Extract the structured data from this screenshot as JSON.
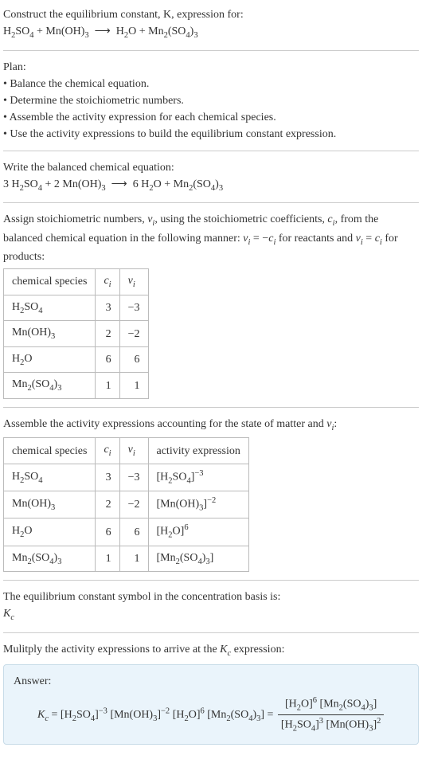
{
  "intro": {
    "line1": "Construct the equilibrium constant, K, expression for:",
    "equation_html": "H<span class=\"sub\">2</span>SO<span class=\"sub\">4</span> + Mn(OH)<span class=\"sub\">3</span> &nbsp;⟶&nbsp; H<span class=\"sub\">2</span>O + Mn<span class=\"sub\">2</span>(SO<span class=\"sub\">4</span>)<span class=\"sub\">3</span>"
  },
  "plan": {
    "title": "Plan:",
    "items": [
      "Balance the chemical equation.",
      "Determine the stoichiometric numbers.",
      "Assemble the activity expression for each chemical species.",
      "Use the activity expressions to build the equilibrium constant expression."
    ]
  },
  "balanced": {
    "title": "Write the balanced chemical equation:",
    "equation_html": "3 H<span class=\"sub\">2</span>SO<span class=\"sub\">4</span> + 2 Mn(OH)<span class=\"sub\">3</span> &nbsp;⟶&nbsp; 6 H<span class=\"sub\">2</span>O + Mn<span class=\"sub\">2</span>(SO<span class=\"sub\">4</span>)<span class=\"sub\">3</span>"
  },
  "stoich": {
    "intro_html": "Assign stoichiometric numbers, <span class=\"italic\">ν<span class=\"sub\">i</span></span>, using the stoichiometric coefficients, <span class=\"italic\">c<span class=\"sub\">i</span></span>, from the balanced chemical equation in the following manner: <span class=\"italic\">ν<span class=\"sub\">i</span></span> = −<span class=\"italic\">c<span class=\"sub\">i</span></span> for reactants and <span class=\"italic\">ν<span class=\"sub\">i</span></span> = <span class=\"italic\">c<span class=\"sub\">i</span></span> for products:",
    "headers": {
      "species": "chemical species",
      "c_html": "<span class=\"italic\">c<span class=\"sub\">i</span></span>",
      "v_html": "<span class=\"italic\">ν<span class=\"sub\">i</span></span>"
    },
    "rows": [
      {
        "species_html": "H<span class=\"sub\">2</span>SO<span class=\"sub\">4</span>",
        "c": "3",
        "v": "−3"
      },
      {
        "species_html": "Mn(OH)<span class=\"sub\">3</span>",
        "c": "2",
        "v": "−2"
      },
      {
        "species_html": "H<span class=\"sub\">2</span>O",
        "c": "6",
        "v": "6"
      },
      {
        "species_html": "Mn<span class=\"sub\">2</span>(SO<span class=\"sub\">4</span>)<span class=\"sub\">3</span>",
        "c": "1",
        "v": "1"
      }
    ]
  },
  "activity": {
    "intro_html": "Assemble the activity expressions accounting for the state of matter and <span class=\"italic\">ν<span class=\"sub\">i</span></span>:",
    "headers": {
      "species": "chemical species",
      "c_html": "<span class=\"italic\">c<span class=\"sub\">i</span></span>",
      "v_html": "<span class=\"italic\">ν<span class=\"sub\">i</span></span>",
      "activity": "activity expression"
    },
    "rows": [
      {
        "species_html": "H<span class=\"sub\">2</span>SO<span class=\"sub\">4</span>",
        "c": "3",
        "v": "−3",
        "act_html": "[H<span class=\"sub\">2</span>SO<span class=\"sub\">4</span>]<span class=\"sup\">−3</span>"
      },
      {
        "species_html": "Mn(OH)<span class=\"sub\">3</span>",
        "c": "2",
        "v": "−2",
        "act_html": "[Mn(OH)<span class=\"sub\">3</span>]<span class=\"sup\">−2</span>"
      },
      {
        "species_html": "H<span class=\"sub\">2</span>O",
        "c": "6",
        "v": "6",
        "act_html": "[H<span class=\"sub\">2</span>O]<span class=\"sup\">6</span>"
      },
      {
        "species_html": "Mn<span class=\"sub\">2</span>(SO<span class=\"sub\">4</span>)<span class=\"sub\">3</span>",
        "c": "1",
        "v": "1",
        "act_html": "[Mn<span class=\"sub\">2</span>(SO<span class=\"sub\">4</span>)<span class=\"sub\">3</span>]"
      }
    ]
  },
  "symbol": {
    "line1": "The equilibrium constant symbol in the concentration basis is:",
    "line2_html": "<span class=\"italic\">K<span class=\"sub\">c</span></span>"
  },
  "multiply": {
    "line_html": "Mulitply the activity expressions to arrive at the <span class=\"italic\">K<span class=\"sub\">c</span></span> expression:"
  },
  "answer": {
    "label": "Answer:",
    "kc_html": "<span class=\"italic\">K<span class=\"sub\">c</span></span> = [H<span class=\"sub\">2</span>SO<span class=\"sub\">4</span>]<span class=\"sup\">−3</span> [Mn(OH)<span class=\"sub\">3</span>]<span class=\"sup\">−2</span> [H<span class=\"sub\">2</span>O]<span class=\"sup\">6</span> [Mn<span class=\"sub\">2</span>(SO<span class=\"sub\">4</span>)<span class=\"sub\">3</span>] = ",
    "frac_top_html": "[H<span class=\"sub\">2</span>O]<span class=\"sup\">6</span> [Mn<span class=\"sub\">2</span>(SO<span class=\"sub\">4</span>)<span class=\"sub\">3</span>]",
    "frac_bot_html": "[H<span class=\"sub\">2</span>SO<span class=\"sub\">4</span>]<span class=\"sup\">3</span> [Mn(OH)<span class=\"sub\">3</span>]<span class=\"sup\">2</span>"
  }
}
